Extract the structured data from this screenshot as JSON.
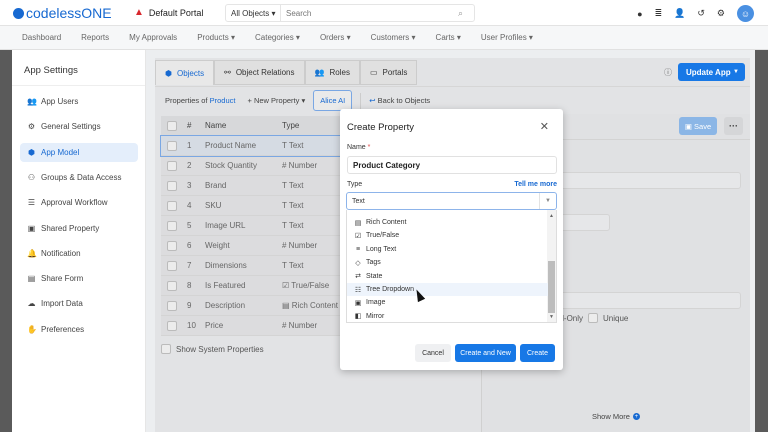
{
  "header": {
    "logo": "codelessONE",
    "portal": "Default Portal",
    "search_scope": "All Objects",
    "search_placeholder": "Search"
  },
  "nav": [
    "Dashboard",
    "Reports",
    "My Approvals",
    "Products ▾",
    "Categories ▾",
    "Orders ▾",
    "Customers ▾",
    "Carts ▾",
    "User Profiles ▾"
  ],
  "sidebar": {
    "title": "App Settings",
    "items": [
      {
        "label": "App Users",
        "icon": "users-icon"
      },
      {
        "label": "General Settings",
        "icon": "gear-icon"
      },
      {
        "label": "App Model",
        "icon": "cube-icon",
        "active": true
      },
      {
        "label": "Groups & Data Access",
        "icon": "group-icon"
      },
      {
        "label": "Approval Workflow",
        "icon": "checklist-icon"
      },
      {
        "label": "Shared Property",
        "icon": "box-icon"
      },
      {
        "label": "Notification",
        "icon": "bell-icon"
      },
      {
        "label": "Share Form",
        "icon": "form-icon"
      },
      {
        "label": "Import Data",
        "icon": "cloud-upload-icon"
      },
      {
        "label": "Preferences",
        "icon": "hand-icon"
      }
    ]
  },
  "tabs": [
    "Objects",
    "Object Relations",
    "Roles",
    "Portals"
  ],
  "update_app": "Update App",
  "props": {
    "prefix": "Properties of",
    "object": "Product",
    "new_property": "+ New Property ▾",
    "alice": "Alice AI",
    "back": "Back to Objects"
  },
  "table": {
    "headers": [
      "#",
      "Name",
      "Type"
    ],
    "rows": [
      {
        "n": "1",
        "name": "Product Name",
        "type": "Text",
        "icon": "T"
      },
      {
        "n": "2",
        "name": "Stock Quantity",
        "type": "Number",
        "icon": "#"
      },
      {
        "n": "3",
        "name": "Brand",
        "type": "Text",
        "icon": "T"
      },
      {
        "n": "4",
        "name": "SKU",
        "type": "Text",
        "icon": "T"
      },
      {
        "n": "5",
        "name": "Image URL",
        "type": "Text",
        "icon": "T"
      },
      {
        "n": "6",
        "name": "Weight",
        "type": "Number",
        "icon": "#"
      },
      {
        "n": "7",
        "name": "Dimensions",
        "type": "Text",
        "icon": "T"
      },
      {
        "n": "8",
        "name": "Is Featured",
        "type": "True/False",
        "icon": "☑"
      },
      {
        "n": "9",
        "name": "Description",
        "type": "Rich Content",
        "icon": "▤"
      },
      {
        "n": "10",
        "name": "Price",
        "type": "Number",
        "icon": "#"
      }
    ]
  },
  "show_system": "Show System Properties",
  "right": {
    "save": "Save",
    "read_only": "ad-Only",
    "unique": "Unique",
    "show_more": "Show More"
  },
  "modal": {
    "title": "Create Property",
    "name_label": "Name",
    "name_value": "Product Category",
    "type_label": "Type",
    "tell_more": "Tell me more",
    "type_value": "Text",
    "options": [
      {
        "label": "Rich Content",
        "icon": "▤"
      },
      {
        "label": "True/False",
        "icon": "☑"
      },
      {
        "label": "Long Text",
        "icon": "≡"
      },
      {
        "label": "Tags",
        "icon": "◇"
      },
      {
        "label": "State",
        "icon": "⇄"
      },
      {
        "label": "Tree Dropdown",
        "icon": "☷",
        "hover": true
      },
      {
        "label": "Image",
        "icon": "▣"
      },
      {
        "label": "Mirror",
        "icon": "◧"
      }
    ],
    "cancel": "Cancel",
    "create_new": "Create and New",
    "create": "Create"
  }
}
